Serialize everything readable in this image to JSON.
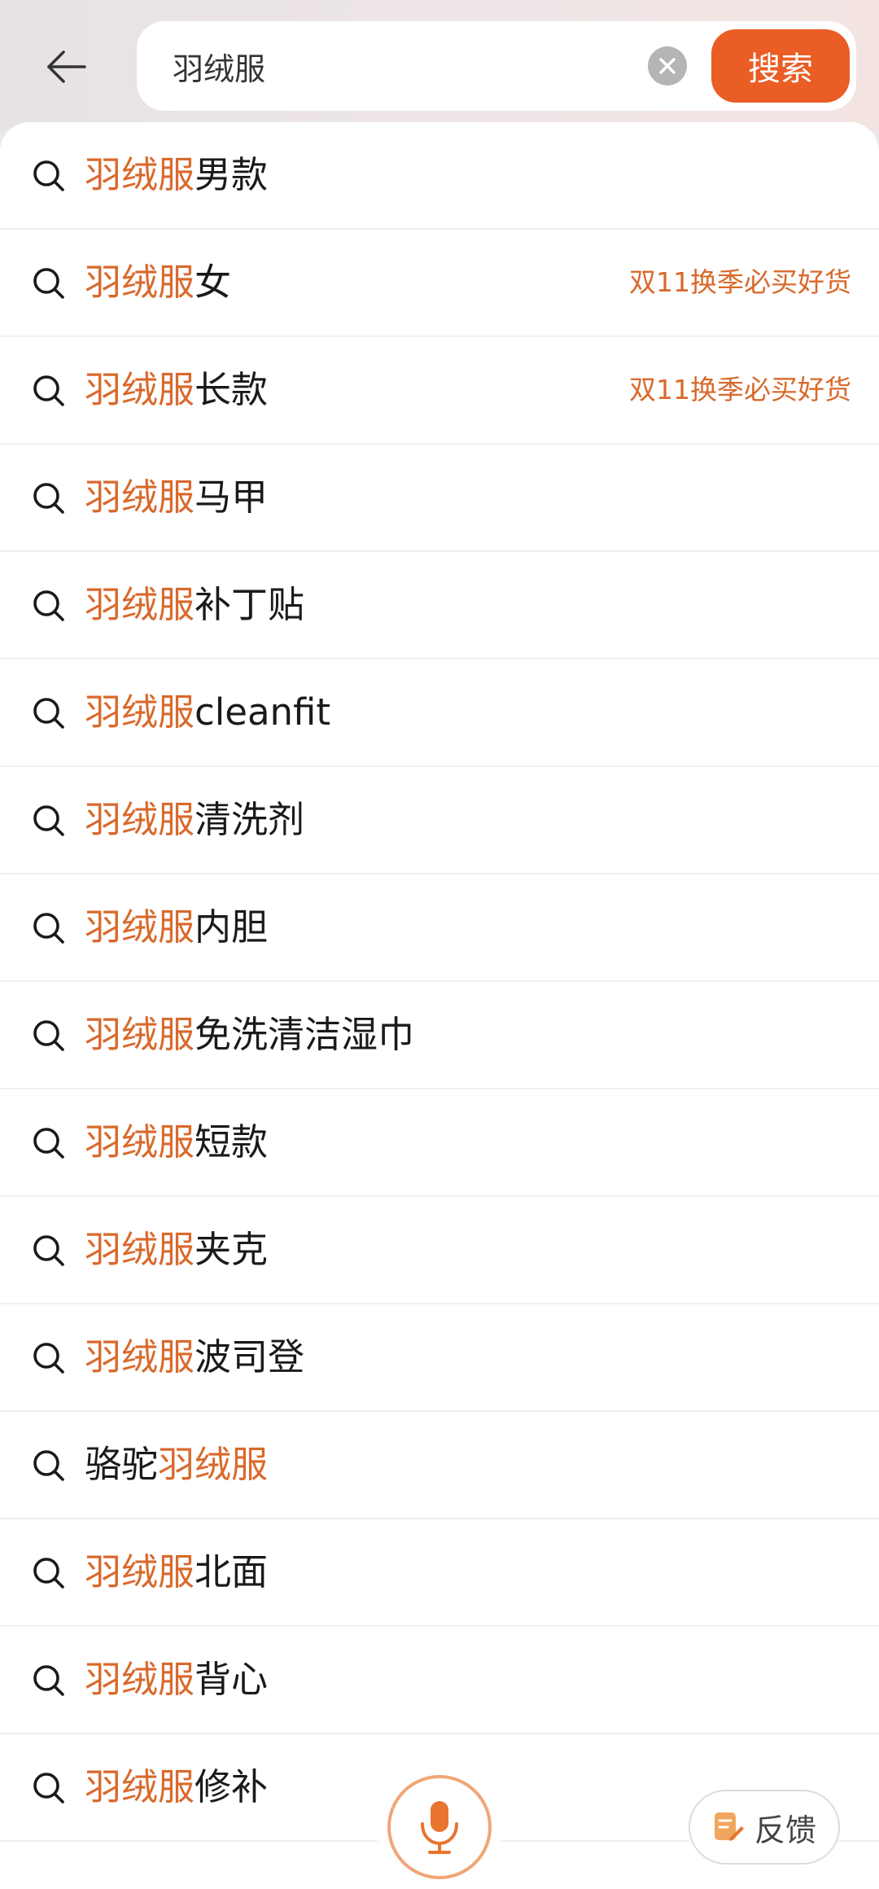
{
  "search": {
    "query": "羽绒服",
    "button_label": "搜索"
  },
  "suggestions": [
    {
      "pre": "",
      "hl": "羽绒服",
      "post": "男款",
      "tag": ""
    },
    {
      "pre": "",
      "hl": "羽绒服",
      "post": "女",
      "tag": "双11换季必买好货"
    },
    {
      "pre": "",
      "hl": "羽绒服",
      "post": "长款",
      "tag": "双11换季必买好货"
    },
    {
      "pre": "",
      "hl": "羽绒服",
      "post": "马甲",
      "tag": ""
    },
    {
      "pre": "",
      "hl": "羽绒服",
      "post": "补丁贴",
      "tag": ""
    },
    {
      "pre": "",
      "hl": "羽绒服",
      "post": "cleanfit",
      "tag": ""
    },
    {
      "pre": "",
      "hl": "羽绒服",
      "post": "清洗剂",
      "tag": ""
    },
    {
      "pre": "",
      "hl": "羽绒服",
      "post": "内胆",
      "tag": ""
    },
    {
      "pre": "",
      "hl": "羽绒服",
      "post": "免洗清洁湿巾",
      "tag": ""
    },
    {
      "pre": "",
      "hl": "羽绒服",
      "post": "短款",
      "tag": ""
    },
    {
      "pre": "",
      "hl": "羽绒服",
      "post": "夹克",
      "tag": ""
    },
    {
      "pre": "",
      "hl": "羽绒服",
      "post": "波司登",
      "tag": ""
    },
    {
      "pre": "骆驼",
      "hl": "羽绒服",
      "post": "",
      "tag": ""
    },
    {
      "pre": "",
      "hl": "羽绒服",
      "post": "北面",
      "tag": ""
    },
    {
      "pre": "",
      "hl": "羽绒服",
      "post": "背心",
      "tag": ""
    },
    {
      "pre": "",
      "hl": "羽绒服",
      "post": "修补",
      "tag": ""
    }
  ],
  "feedback": {
    "label": "反馈"
  },
  "icons": {
    "back": "arrow-left-icon",
    "clear": "clear-icon",
    "suggestion": "search-icon",
    "mic": "microphone-icon",
    "feedback": "feedback-icon"
  },
  "colors": {
    "accent": "#ea5d24",
    "highlight": "#d9692c"
  }
}
